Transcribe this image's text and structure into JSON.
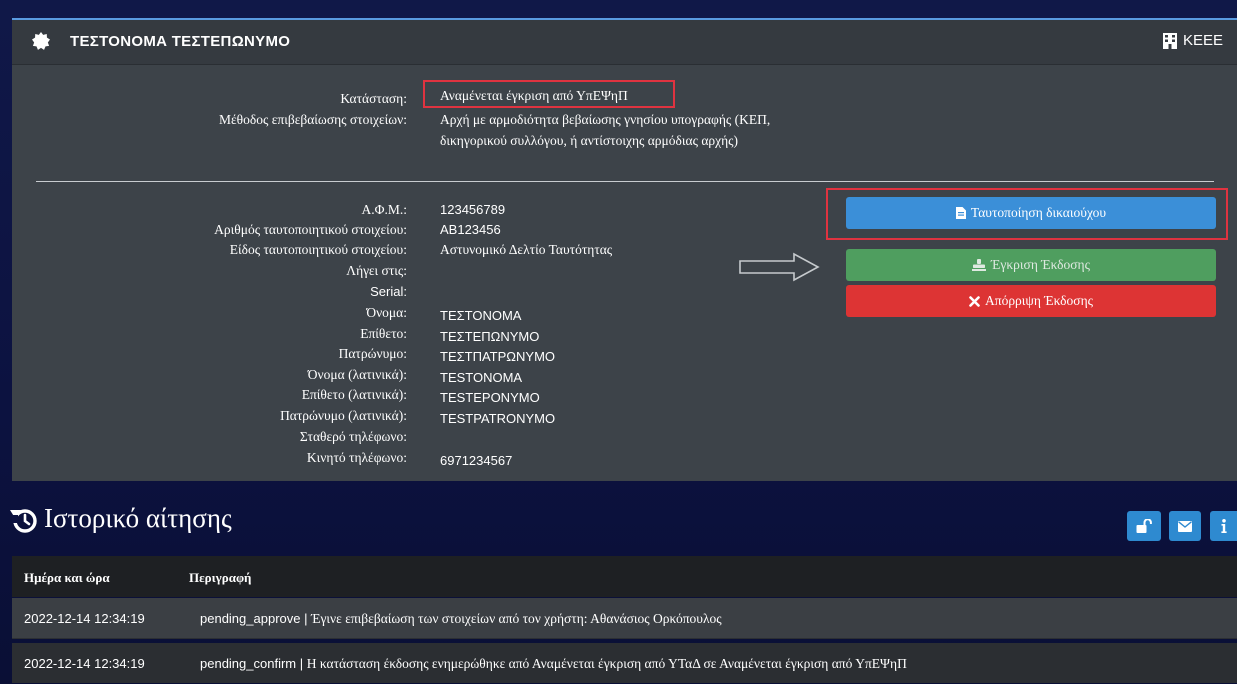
{
  "header": {
    "title": "ΤΕΣΤΟΝΟΜΑ ΤΕΣΤΕΠΩΝΥΜΟ",
    "org": "ΚΕΕΕ",
    "title_icon": "badge-icon",
    "org_icon": "building-icon"
  },
  "status": {
    "label": "Κατάσταση:",
    "value": "Αναμένεται έγκριση από ΥπΕΨηΠ"
  },
  "method": {
    "label": "Μέθοδος επιβεβαίωσης στοιχείων:",
    "value": "Αρχή με αρμοδιότητα βεβαίωσης γνησίου υπογραφής (ΚΕΠ, δικηγορικού συλλόγου, ή αντίστοιχης αρμόδιας αρχής)"
  },
  "fields": [
    {
      "label": "Α.Φ.Μ.:",
      "value": "123456789"
    },
    {
      "label": "Αριθμός ταυτοποιητικού στοιχείου:",
      "value": "AB123456"
    },
    {
      "label": "Είδος ταυτοποιητικού στοιχείου:",
      "value": "Αστυνομικό Δελτίο Ταυτότητας"
    },
    {
      "label": "Λήγει στις:",
      "value": ""
    },
    {
      "label": "Serial:",
      "value": ""
    },
    {
      "label": "Όνομα:",
      "value": "ΤΕΣΤΟΝΟΜΑ"
    },
    {
      "label": "Επίθετο:",
      "value": "ΤΕΣΤΕΠΩΝΥΜΟ"
    },
    {
      "label": "Πατρώνυμο:",
      "value": "ΤΕΣΤΠΑΤΡΩΝΥΜΟ"
    },
    {
      "label": "Όνομα (λατινικά):",
      "value": "TESTONOMA"
    },
    {
      "label": "Επίθετο (λατινικά):",
      "value": "TESTEPONYMO"
    },
    {
      "label": "Πατρώνυμο (λατινικά):",
      "value": "TESTPATRONYMO"
    },
    {
      "label": "Σταθερό τηλέφωνο:",
      "value": ""
    },
    {
      "label": "Κινητό τηλέφωνο:",
      "value": "6971234567"
    }
  ],
  "actions": {
    "identify": "Ταυτοποίηση δικαιούχου",
    "approve": "Έγκριση Έκδοσης",
    "reject": "Απόρριψη Έκδοσης"
  },
  "history": {
    "title": "Ιστορικό αίτησης",
    "columns": [
      "Ημέρα και ώρα",
      "Περιγραφή"
    ],
    "rows": [
      {
        "datetime": "2022-12-14 12:34:19",
        "code": "pending_approve | ",
        "text": "Έγινε επιβεβαίωση των στοιχείων από τον χρήστη: Αθανάσιος Ορκόπουλος"
      },
      {
        "datetime": "2022-12-14 12:34:19",
        "code": "pending_confirm | ",
        "text": "Η κατάσταση έκδοσης ενημερώθηκε από Αναμένεται έγκριση από ΥΤαΔ σε Αναμένεται έγκριση από ΥπΕΨηΠ"
      }
    ]
  },
  "colors": {
    "accent_blue": "#3b8fd8",
    "approve_green": "#4f9e5f",
    "reject_red": "#dd3434",
    "highlight_red": "#e03340"
  }
}
